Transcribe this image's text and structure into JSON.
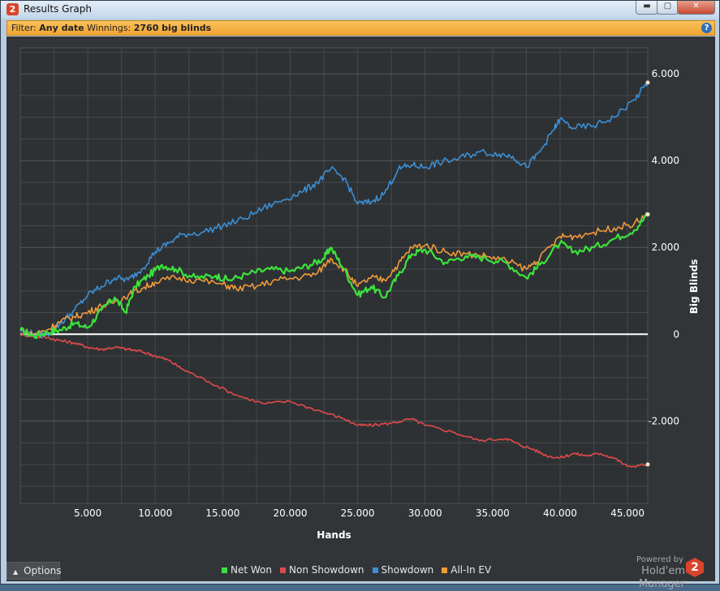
{
  "window": {
    "icon_text": "2",
    "title": "Results Graph",
    "buttons": {
      "minimize": "▬",
      "maximize": "▢",
      "close": "✕"
    }
  },
  "filter": {
    "filter_label": "Filter:",
    "filter_value": "Any date",
    "winnings_label": "Winnings:",
    "winnings_value": "2760 big blinds",
    "help_icon": "?"
  },
  "options_button": {
    "arrow": "▲",
    "label": "Options"
  },
  "branding": {
    "powered_by": "Powered by",
    "name": "Hold'em Manager",
    "logo": "2"
  },
  "colors": {
    "background": "#323538",
    "grid": "#45494c",
    "zero_line": "#ffffff",
    "net_won": "#3ce23c",
    "non_showdown": "#e24a4a",
    "showdown": "#3b8fd6",
    "all_in_ev": "#f09a3a"
  },
  "chart_data": {
    "type": "line",
    "title": "",
    "xlabel": "Hands",
    "ylabel": "Big Blinds",
    "xlim": [
      0,
      46500
    ],
    "ylim": [
      -3900,
      6600
    ],
    "x_ticks": [
      5000,
      10000,
      15000,
      20000,
      25000,
      30000,
      35000,
      40000,
      45000
    ],
    "x_tick_labels": [
      "5.000",
      "10.000",
      "15.000",
      "20.000",
      "25.000",
      "30.000",
      "35.000",
      "40.000",
      "45.000"
    ],
    "y_ticks": [
      -2000,
      0,
      2000,
      4000,
      6000
    ],
    "y_tick_labels": [
      "-2.000",
      "0",
      "2.000",
      "4.000",
      "6.000"
    ],
    "y_axis_side": "right",
    "grid": true,
    "legend_position": "bottom",
    "series": [
      {
        "name": "Net Won",
        "color": "#3ce23c",
        "x": [
          0,
          1000,
          2000,
          3000,
          4000,
          5000,
          6000,
          7000,
          7800,
          8500,
          9500,
          10500,
          11500,
          13000,
          14500,
          15500,
          17000,
          18500,
          20000,
          21500,
          22500,
          23000,
          24000,
          25000,
          26000,
          27000,
          28000,
          29000,
          30000,
          31500,
          33000,
          34500,
          36000,
          37500,
          38500,
          40000,
          41000,
          42500,
          44000,
          45500,
          46500
        ],
        "y": [
          100,
          -50,
          50,
          100,
          250,
          150,
          550,
          850,
          500,
          1100,
          1350,
          1600,
          1500,
          1300,
          1350,
          1250,
          1400,
          1500,
          1450,
          1600,
          1750,
          2000,
          1500,
          900,
          1100,
          850,
          1350,
          1850,
          1950,
          1650,
          1800,
          1750,
          1650,
          1300,
          1600,
          2100,
          1900,
          2000,
          2200,
          2400,
          2760
        ]
      },
      {
        "name": "Non Showdown",
        "color": "#e24a4a",
        "x": [
          0,
          1000,
          2000,
          3000,
          4000,
          5000,
          6000,
          7000,
          8000,
          9000,
          10000,
          11000,
          12000,
          14000,
          16000,
          18000,
          20000,
          22000,
          24000,
          25000,
          26000,
          27500,
          29000,
          30000,
          32000,
          34000,
          36000,
          37000,
          38000,
          39000,
          40000,
          41000,
          42000,
          43000,
          44000,
          45000,
          46500
        ],
        "y": [
          0,
          -50,
          -80,
          -150,
          -200,
          -300,
          -350,
          -300,
          -350,
          -400,
          -500,
          -600,
          -800,
          -1100,
          -1400,
          -1600,
          -1550,
          -1750,
          -1950,
          -2100,
          -2100,
          -2050,
          -1950,
          -2100,
          -2250,
          -2450,
          -2400,
          -2550,
          -2650,
          -2800,
          -2850,
          -2750,
          -2800,
          -2750,
          -2850,
          -3050,
          -3000
        ]
      },
      {
        "name": "Showdown",
        "color": "#3b8fd6",
        "x": [
          0,
          1000,
          2000,
          3000,
          4000,
          5000,
          6000,
          7000,
          8000,
          9000,
          10000,
          11000,
          12000,
          13500,
          15000,
          16500,
          18000,
          19500,
          21000,
          22000,
          23000,
          24000,
          25000,
          26000,
          27000,
          28000,
          29000,
          30000,
          31000,
          32500,
          34000,
          35500,
          36500,
          37500,
          38500,
          39500,
          40000,
          41000,
          42500,
          44000,
          45500,
          46500
        ],
        "y": [
          100,
          0,
          0,
          250,
          550,
          900,
          1100,
          1300,
          1250,
          1500,
          1900,
          2100,
          2300,
          2350,
          2500,
          2650,
          2900,
          3100,
          3300,
          3500,
          3800,
          3600,
          3000,
          3050,
          3250,
          3800,
          3900,
          3850,
          3950,
          4050,
          4200,
          4150,
          4100,
          3850,
          4200,
          4700,
          4950,
          4750,
          4800,
          5000,
          5400,
          5800
        ]
      },
      {
        "name": "All-In EV",
        "color": "#f09a3a",
        "x": [
          0,
          1000,
          2000,
          3000,
          4000,
          5000,
          6000,
          7000,
          8000,
          9000,
          10000,
          11500,
          13000,
          15000,
          16000,
          17500,
          19000,
          20500,
          22000,
          23000,
          24000,
          25000,
          26000,
          27000,
          28000,
          29000,
          30000,
          31500,
          33000,
          34500,
          36000,
          37500,
          38500,
          40000,
          41000,
          42500,
          44000,
          45500,
          46500
        ],
        "y": [
          100,
          0,
          100,
          300,
          400,
          500,
          650,
          750,
          900,
          1050,
          1200,
          1300,
          1250,
          1150,
          1050,
          1100,
          1250,
          1300,
          1400,
          1750,
          1500,
          1100,
          1300,
          1250,
          1600,
          2000,
          2050,
          1900,
          1850,
          1800,
          1700,
          1500,
          1750,
          2250,
          2250,
          2350,
          2450,
          2550,
          2760
        ]
      }
    ]
  }
}
